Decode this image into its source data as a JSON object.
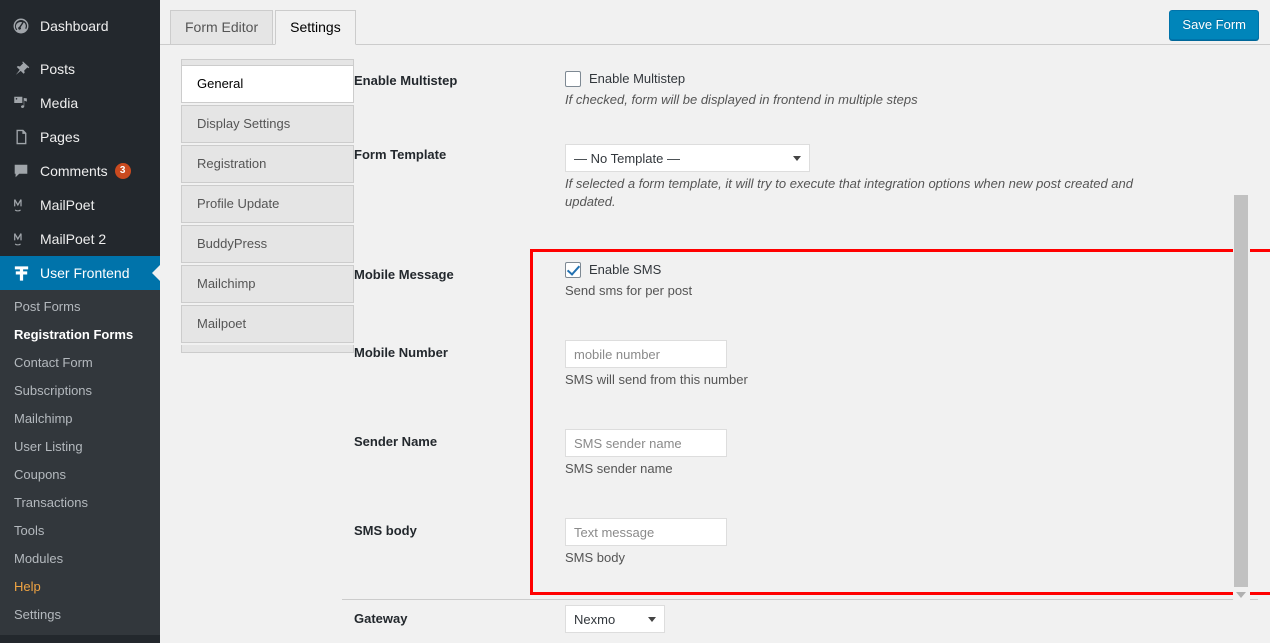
{
  "sidebar": {
    "items": [
      {
        "label": "Dashboard",
        "icon": "dashboard-icon",
        "current": false,
        "count": null
      },
      {
        "label": "Posts",
        "icon": "pin-icon",
        "current": false,
        "count": null
      },
      {
        "label": "Media",
        "icon": "media-icon",
        "current": false,
        "count": null
      },
      {
        "label": "Pages",
        "icon": "pages-icon",
        "current": false,
        "count": null
      },
      {
        "label": "Comments",
        "icon": "comments-icon",
        "current": false,
        "count": "3"
      },
      {
        "label": "MailPoet",
        "icon": "mailpoet-icon",
        "current": false,
        "count": null
      },
      {
        "label": "MailPoet 2",
        "icon": "mailpoet-icon",
        "current": false,
        "count": null
      },
      {
        "label": "User Frontend",
        "icon": "user-frontend-icon",
        "current": true,
        "count": null
      }
    ],
    "submenu": [
      {
        "label": "Post Forms",
        "current": false,
        "highlight": false
      },
      {
        "label": "Registration Forms",
        "current": true,
        "highlight": false
      },
      {
        "label": "Contact Form",
        "current": false,
        "highlight": false
      },
      {
        "label": "Subscriptions",
        "current": false,
        "highlight": false
      },
      {
        "label": "Mailchimp",
        "current": false,
        "highlight": false
      },
      {
        "label": "User Listing",
        "current": false,
        "highlight": false
      },
      {
        "label": "Coupons",
        "current": false,
        "highlight": false
      },
      {
        "label": "Transactions",
        "current": false,
        "highlight": false
      },
      {
        "label": "Tools",
        "current": false,
        "highlight": false
      },
      {
        "label": "Modules",
        "current": false,
        "highlight": false
      },
      {
        "label": "Help",
        "current": false,
        "highlight": true
      },
      {
        "label": "Settings",
        "current": false,
        "highlight": false
      }
    ]
  },
  "topbar": {
    "tabs": [
      {
        "label": "Form Editor",
        "active": false
      },
      {
        "label": "Settings",
        "active": true
      }
    ],
    "save_label": "Save Form"
  },
  "vertical_tabs": [
    {
      "label": "General",
      "active": true
    },
    {
      "label": "Display Settings",
      "active": false
    },
    {
      "label": "Registration",
      "active": false
    },
    {
      "label": "Profile Update",
      "active": false
    },
    {
      "label": "BuddyPress",
      "active": false
    },
    {
      "label": "Mailchimp",
      "active": false
    },
    {
      "label": "Mailpoet",
      "active": false
    }
  ],
  "fields": {
    "multistep": {
      "label": "Enable Multistep",
      "checkbox_label": "Enable Multistep",
      "checked": false,
      "description": "If checked, form will be displayed in frontend in multiple steps"
    },
    "form_template": {
      "label": "Form Template",
      "value": "— No Template —",
      "options": [
        "— No Template —"
      ],
      "description": "If selected a form template, it will try to execute that integration options when new post created and updated."
    },
    "mobile_message": {
      "label": "Mobile Message",
      "checkbox_label": "Enable SMS",
      "checked": true,
      "description": "Send sms for per post"
    },
    "mobile_number": {
      "label": "Mobile Number",
      "value": "",
      "placeholder": "mobile number",
      "description": "SMS will send from this number"
    },
    "sender_name": {
      "label": "Sender Name",
      "value": "",
      "placeholder": "SMS sender name",
      "description": "SMS sender name"
    },
    "sms_body": {
      "label": "SMS body",
      "value": "",
      "placeholder": "Text message",
      "description": "SMS body"
    },
    "gateway": {
      "label": "Gateway",
      "value": "Nexmo",
      "options": [
        "Nexmo"
      ],
      "description": ""
    }
  },
  "colors": {
    "accent": "#0073aa",
    "save_button": "#0085ba",
    "highlight_box": "#ff0000",
    "help_link": "#f0a443",
    "badge": "#ca4a1f",
    "sidebar_bg": "#23282d",
    "submenu_bg": "#32373c"
  }
}
